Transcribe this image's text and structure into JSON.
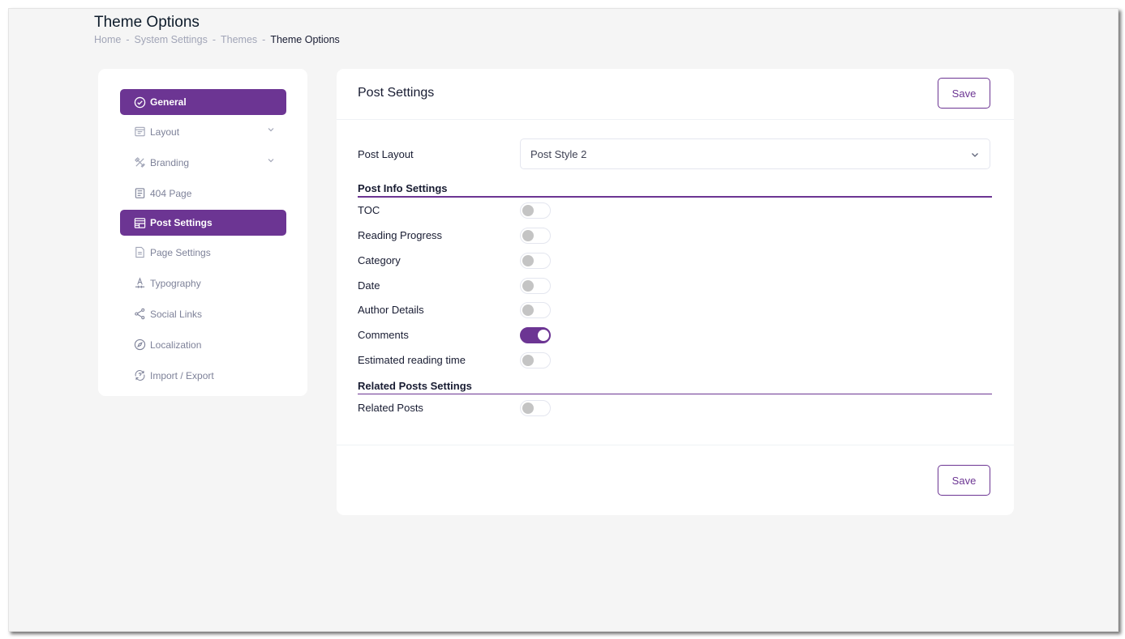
{
  "page": {
    "title": "Theme Options",
    "breadcrumb": [
      "Home",
      "System Settings",
      "Themes",
      "Theme Options"
    ],
    "breadcrumb_separator": "-"
  },
  "sidebar": {
    "accent_color": "#6c3593",
    "items": [
      {
        "label": "General",
        "icon": "check-circle-icon",
        "active": true,
        "has_submenu": false
      },
      {
        "label": "Layout",
        "icon": "layout-icon",
        "active": false,
        "has_submenu": true
      },
      {
        "label": "Branding",
        "icon": "branding-tools-icon",
        "active": false,
        "has_submenu": true
      },
      {
        "label": "404 Page",
        "icon": "document-icon",
        "active": false,
        "has_submenu": false
      },
      {
        "label": "Post Settings",
        "icon": "post-layout-icon",
        "active": true,
        "has_submenu": false
      },
      {
        "label": "Page Settings",
        "icon": "file-icon",
        "active": false,
        "has_submenu": false
      },
      {
        "label": "Typography",
        "icon": "typography-icon",
        "active": false,
        "has_submenu": false
      },
      {
        "label": "Social Links",
        "icon": "share-icon",
        "active": false,
        "has_submenu": false
      },
      {
        "label": "Localization",
        "icon": "compass-icon",
        "active": false,
        "has_submenu": false
      },
      {
        "label": "Import / Export",
        "icon": "import-export-icon",
        "active": false,
        "has_submenu": false
      }
    ]
  },
  "panel": {
    "title": "Post Settings",
    "save_label": "Save",
    "post_layout": {
      "label": "Post Layout",
      "value": "Post Style 2"
    },
    "post_info_section": "Post Info Settings",
    "post_info_toggles": [
      {
        "label": "TOC",
        "on": false
      },
      {
        "label": "Reading Progress",
        "on": false
      },
      {
        "label": "Category",
        "on": false
      },
      {
        "label": "Date",
        "on": false
      },
      {
        "label": "Author Details",
        "on": false
      },
      {
        "label": "Comments",
        "on": true
      },
      {
        "label": "Estimated reading time",
        "on": false
      }
    ],
    "related_section": "Related Posts Settings",
    "related_toggles": [
      {
        "label": "Related Posts",
        "on": false
      }
    ]
  }
}
